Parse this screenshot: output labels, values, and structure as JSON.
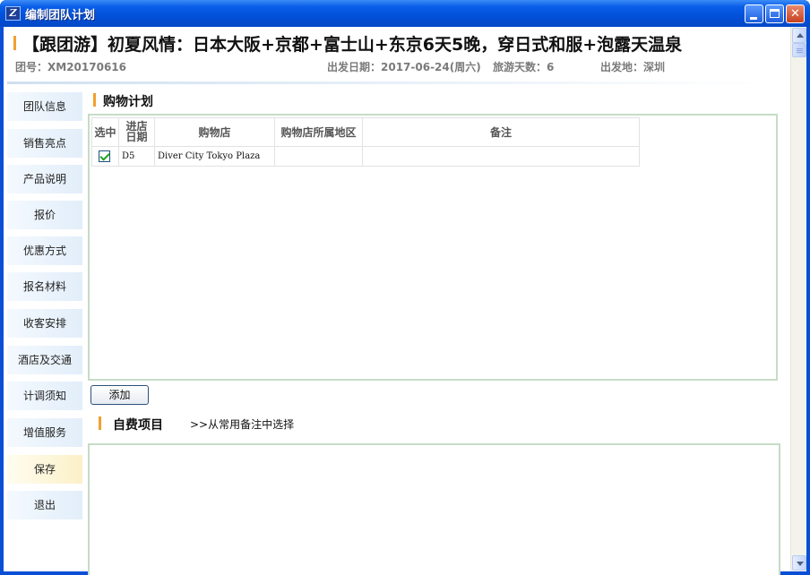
{
  "window": {
    "title": "编制团队计划",
    "app_icon_glyph": "Z"
  },
  "header": {
    "tour_title": "【跟团游】初夏风情：日本大阪+京都+富士山+东京6天5晚，穿日式和服+泡露天温泉",
    "group_code": "团号：XM20170616",
    "departure_date": "出发日期：2017-06-24(周六)",
    "days": "旅游天数：6",
    "origin": "出发地：深圳"
  },
  "sidebar": {
    "items": [
      {
        "label": "团队信息"
      },
      {
        "label": "销售亮点"
      },
      {
        "label": "产品说明"
      },
      {
        "label": "报价"
      },
      {
        "label": "优惠方式"
      },
      {
        "label": "报名材料"
      },
      {
        "label": "收客安排"
      },
      {
        "label": "酒店及交通"
      },
      {
        "label": "计调须知"
      },
      {
        "label": "增值服务"
      },
      {
        "label": "保存"
      },
      {
        "label": "退出"
      }
    ]
  },
  "shopping": {
    "title": "购物计划",
    "columns": {
      "select": "选中",
      "day_line1": "进店",
      "day_line2": "日期",
      "store": "购物店",
      "region": "购物店所属地区",
      "note": "备注"
    },
    "rows": [
      {
        "checked": true,
        "day": "D5",
        "store": "Diver City Tokyo Plaza",
        "region": "",
        "note": ""
      }
    ],
    "add_label": "添加"
  },
  "optional": {
    "title": "自费项目",
    "pick_from_common": ">>从常用备注中选择",
    "text": ""
  },
  "colors": {
    "titlebar": "#0250d8",
    "accent": "#f0a030",
    "panel_border": "#c6dcc6",
    "check": "#21a121"
  }
}
